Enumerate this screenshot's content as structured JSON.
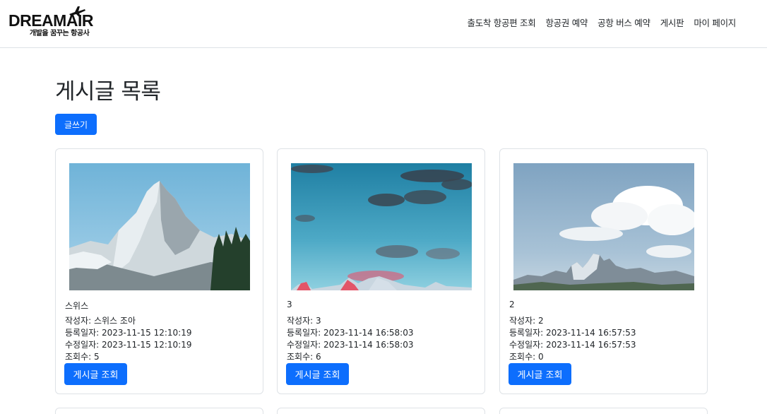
{
  "brand": {
    "name": "DREAMAIR",
    "tagline": "개발을 꿈꾸는 항공사"
  },
  "nav": {
    "items": [
      {
        "label": "출도착 항공편 조회"
      },
      {
        "label": "항공권 예약"
      },
      {
        "label": "공항 버스 예약"
      },
      {
        "label": "게시판"
      },
      {
        "label": "마이 페이지"
      }
    ]
  },
  "page": {
    "title": "게시글 목록",
    "write_label": "글쓰기"
  },
  "cards": [
    {
      "title": "스위스",
      "author": "작성자: 스위스 조아",
      "created": "등록일자: 2023-11-15 12:10:19",
      "modified": "수정일자: 2023-11-15 12:10:19",
      "views": "조회수: 5",
      "button": "게시글 조회",
      "image": "rocky-mountain-peak"
    },
    {
      "title": "3",
      "author": "작성자: 3",
      "created": "등록일자: 2023-11-14 16:58:03",
      "modified": "수정일자: 2023-11-14 16:58:03",
      "views": "조회수: 6",
      "button": "게시글 조회",
      "image": "blue-sky-clouds"
    },
    {
      "title": "2",
      "author": "작성자: 2",
      "created": "등록일자: 2023-11-14 16:57:53",
      "modified": "수정일자: 2023-11-14 16:57:53",
      "views": "조회수: 0",
      "button": "게시글 조회",
      "image": "mountain-clouds"
    }
  ],
  "colors": {
    "primary": "#0d6efd",
    "border": "#dee2e6",
    "text": "#212529"
  }
}
